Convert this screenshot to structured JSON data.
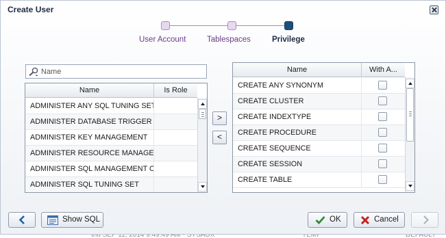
{
  "dialog": {
    "title": "Create User"
  },
  "wizard": {
    "steps": [
      {
        "label": "User Account",
        "state": "done"
      },
      {
        "label": "Tablespaces",
        "state": "done"
      },
      {
        "label": "Privilege",
        "state": "current"
      }
    ]
  },
  "search": {
    "placeholder": "Name",
    "value": ""
  },
  "available": {
    "columns": [
      "Name",
      "Is Role"
    ],
    "rows": [
      {
        "name": "ADMINISTER ANY SQL TUNING SET",
        "is_role": ""
      },
      {
        "name": "ADMINISTER DATABASE TRIGGER",
        "is_role": ""
      },
      {
        "name": "ADMINISTER KEY MANAGEMENT",
        "is_role": ""
      },
      {
        "name": "ADMINISTER RESOURCE MANAGER",
        "is_role": ""
      },
      {
        "name": "ADMINISTER SQL MANAGEMENT OBJ",
        "is_role": ""
      },
      {
        "name": "ADMINISTER SQL TUNING SET",
        "is_role": ""
      }
    ],
    "scroll_position": 0
  },
  "shuttle": {
    "add_label": ">",
    "remove_label": "<"
  },
  "selected": {
    "columns": [
      "Name",
      "With A..."
    ],
    "rows": [
      {
        "name": "CREATE ANY SYNONYM",
        "with_admin": false
      },
      {
        "name": "CREATE CLUSTER",
        "with_admin": false
      },
      {
        "name": "CREATE INDEXTYPE",
        "with_admin": false
      },
      {
        "name": "CREATE PROCEDURE",
        "with_admin": false
      },
      {
        "name": "CREATE SEQUENCE",
        "with_admin": false
      },
      {
        "name": "CREATE SESSION",
        "with_admin": false
      },
      {
        "name": "CREATE TABLE",
        "with_admin": false
      }
    ]
  },
  "footer": {
    "back_icon": "back-arrow-icon",
    "show_sql_label": "Show SQL",
    "ok_label": "OK",
    "cancel_label": "Cancel",
    "next_icon": "next-arrow-icon"
  },
  "colors": {
    "accent": "#1f4e7a",
    "done_step": "#6b3a87",
    "ok_check": "#2e8b2e",
    "cancel_x": "#c81e1e"
  }
}
